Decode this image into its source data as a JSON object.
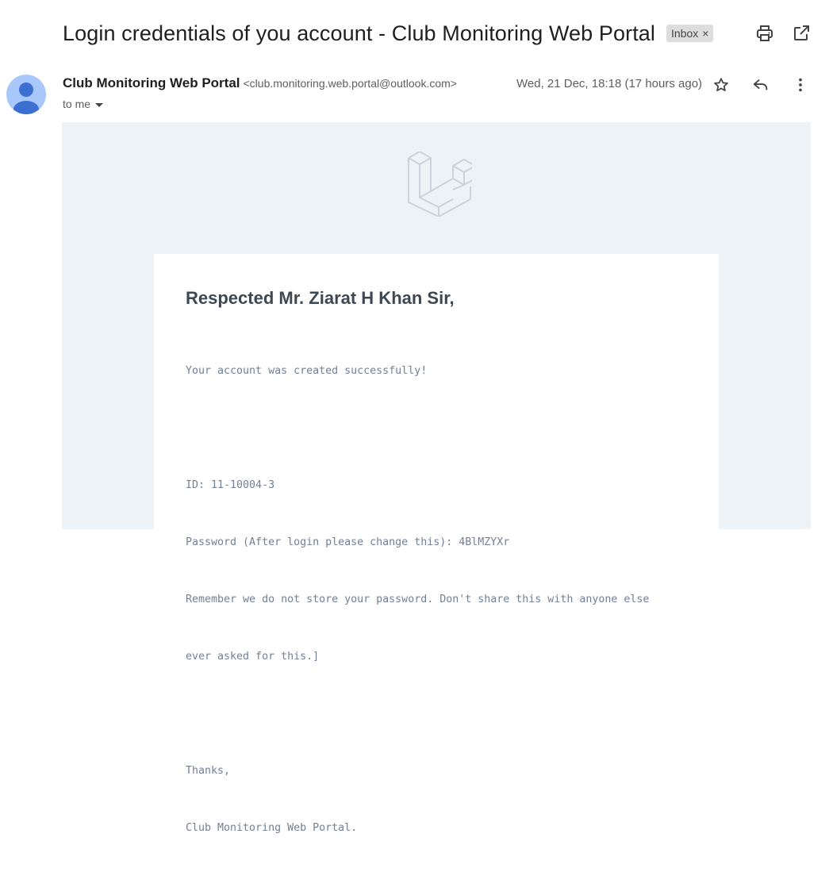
{
  "subject": "Login credentials of you account - Club Monitoring Web Portal",
  "label": {
    "name": "Inbox",
    "remove": "×"
  },
  "toolbar": {
    "print_icon": "print-icon",
    "popout_icon": "open-in-new-window-icon"
  },
  "sender": {
    "name": "Club Monitoring Web Portal",
    "email": "<club.monitoring.web.portal@outlook.com>",
    "date": "Wed, 21 Dec, 18:18 (17 hours ago)",
    "to": "to me",
    "avatar_icon": "person-avatar-icon",
    "avatar_color": "#a8c7fa"
  },
  "actions": {
    "star_icon": "star-icon",
    "reply_icon": "reply-icon",
    "more_icon": "more-vertical-icon"
  },
  "mail": {
    "logo_icon": "laravel-logo",
    "background": "#edf2f7",
    "greeting": "Respected Mr. Ziarat H Khan Sir,",
    "lines": [
      "Your account was created successfully!",
      "",
      "ID: 11-10004-3",
      "Password (After login please change this): 4BlMZYXr",
      "Remember we do not store your password. Don't share this with anyone else",
      "ever asked for this.]",
      "",
      "Thanks,",
      "Club Monitoring Web Portal."
    ]
  }
}
